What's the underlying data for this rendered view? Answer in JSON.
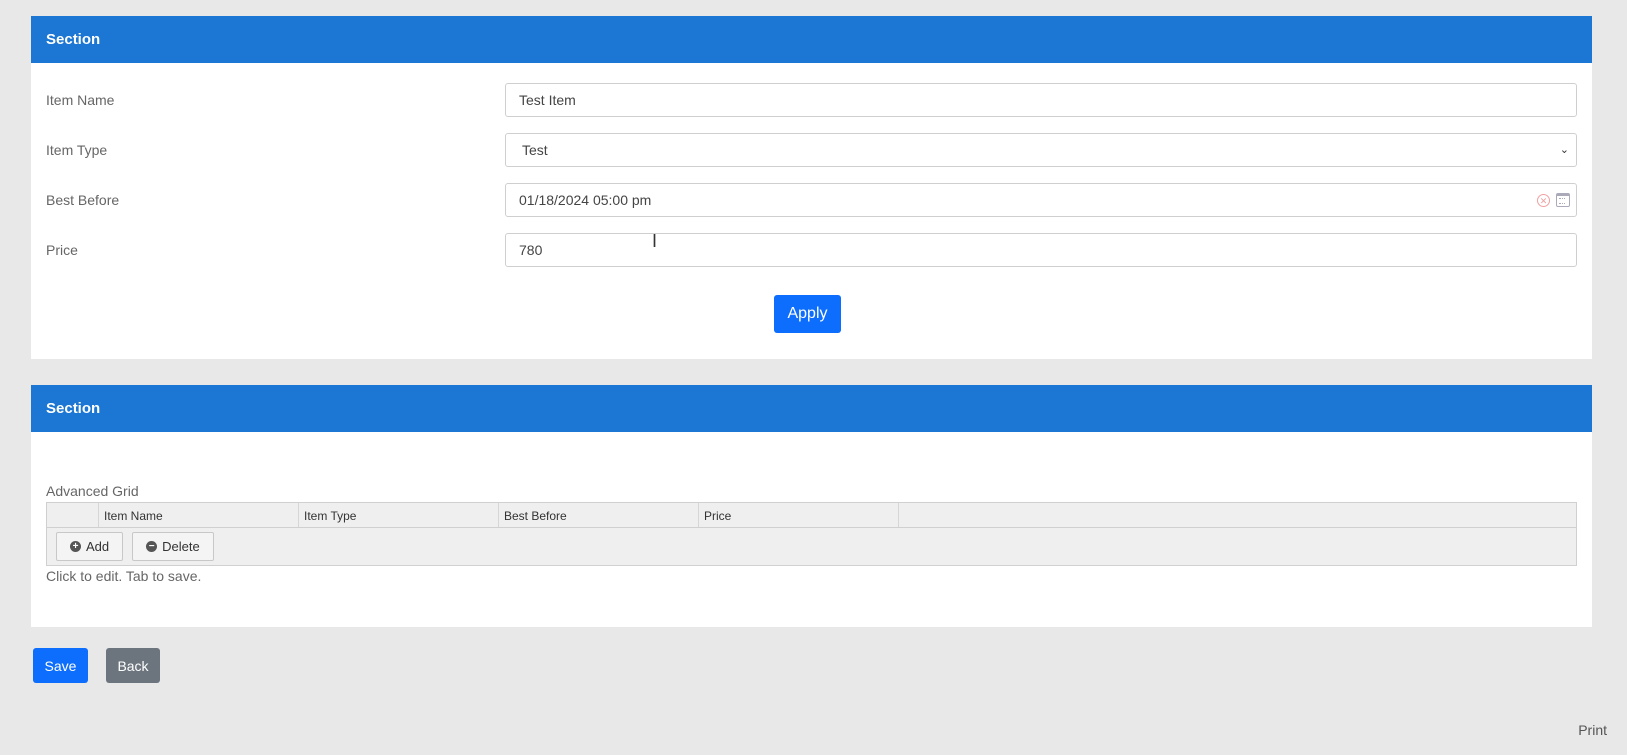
{
  "section1": {
    "title": "Section",
    "fields": {
      "item_name": {
        "label": "Item Name",
        "value": "Test Item"
      },
      "item_type": {
        "label": "Item Type",
        "value": "Test"
      },
      "best_before": {
        "label": "Best Before",
        "value": "01/18/2024 05:00 pm"
      },
      "price": {
        "label": "Price",
        "value": "780"
      }
    },
    "apply_label": "Apply"
  },
  "section2": {
    "title": "Section",
    "grid_caption": "Advanced Grid",
    "columns": [
      "",
      "Item Name",
      "Item Type",
      "Best Before",
      "Price",
      ""
    ],
    "add_label": "Add",
    "delete_label": "Delete",
    "hint": "Click to edit. Tab to save."
  },
  "footer": {
    "save_label": "Save",
    "back_label": "Back",
    "print_label": "Print"
  }
}
